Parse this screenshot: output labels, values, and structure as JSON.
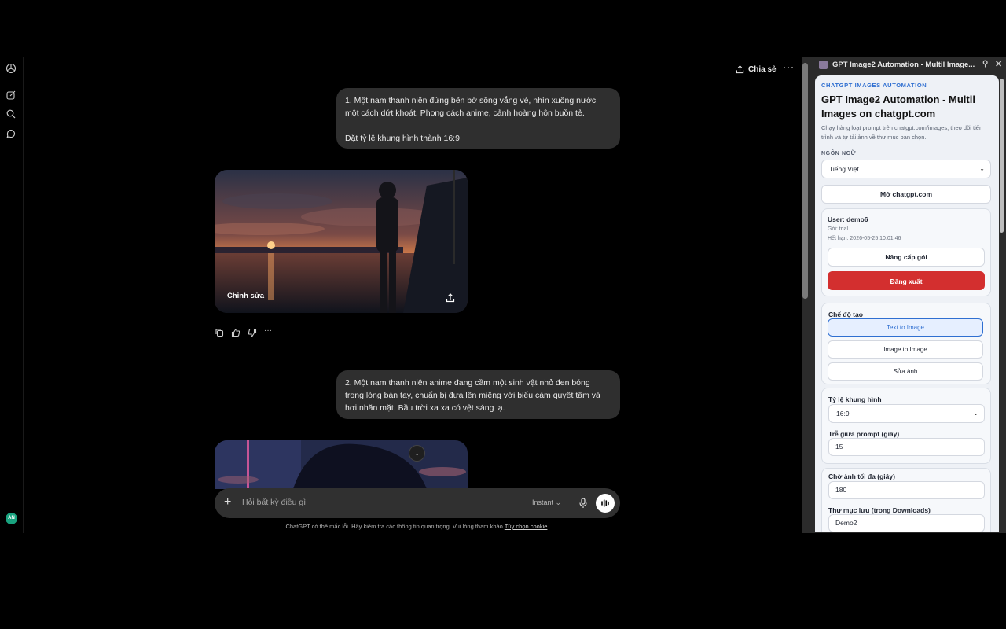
{
  "chat": {
    "header": {
      "share_label": "Chia sẻ",
      "more": "···"
    },
    "messages": [
      {
        "line1": "1. Một nam thanh niên đứng bên bờ sông vắng vẻ, nhìn xuống nước",
        "line2": "một cách dứt khoát. Phong cách anime, cảnh hoàng hôn buồn tẻ.",
        "line3": "Đặt tỷ lệ khung hình thành 16:9"
      },
      {
        "line1": "2. Một nam thanh niên anime đang cầm một sinh vật nhỏ đen bóng",
        "line2": "trong lòng bàn tay, chuẩn bị đưa lên miệng với biểu cảm quyết tâm và",
        "line3": "hơi nhăn mặt. Bầu trời xa xa có vệt sáng lạ."
      }
    ],
    "image_edit_label": "Chỉnh sửa",
    "composer": {
      "placeholder": "Hỏi bất kỳ điều gì",
      "mode": "Instant"
    },
    "disclaimer": "ChatGPT có thể mắc lỗi. Hãy kiểm tra các thông tin quan trọng. Vui lòng tham khảo",
    "disclaimer_link": "Tùy chọn cookie",
    "avatar_initials": "AN"
  },
  "extension": {
    "window_title": "GPT Image2 Automation - Multil Image...",
    "eyebrow": "CHATGPT IMAGES AUTOMATION",
    "title": "GPT Image2 Automation - Multil Images on chatgpt.com",
    "description": "Chạy hàng loạt prompt trên chatgpt.com/images, theo dõi tiến trình và tự tải ảnh về thư mục bạn chọn.",
    "language_label": "NGÔN NGỮ",
    "language_value": "Tiếng Việt",
    "open_button": "Mở chatgpt.com",
    "account": {
      "user": "User: demo6",
      "plan": "Gói: trial",
      "expiry": "Hết hạn: 2026-05-25 10:01:46",
      "upgrade": "Nâng cấp gói",
      "logout": "Đăng xuất"
    },
    "mode": {
      "label": "Chế độ tạo",
      "options": [
        "Text to Image",
        "Image to Image",
        "Sửa ảnh"
      ]
    },
    "aspect": {
      "label": "Tỷ lệ khung hình",
      "value": "16:9"
    },
    "delay": {
      "label": "Trễ giữa prompt (giây)",
      "value": "15"
    },
    "max_wait": {
      "label": "Chờ ảnh tối đa (giây)",
      "value": "180"
    },
    "folder": {
      "label": "Thư mục lưu (trong Downloads)",
      "value": "Demo2"
    }
  },
  "colors": {
    "accent": "#2f6fd1",
    "danger": "#d32f2f",
    "bubble": "#2f2f2f"
  }
}
